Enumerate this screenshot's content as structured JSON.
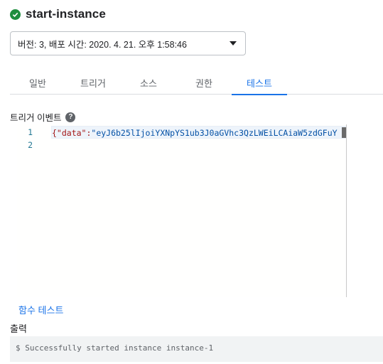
{
  "header": {
    "title": "start-instance",
    "status_icon": "check-circle-icon",
    "status_color": "#1e8e3e"
  },
  "version_select": {
    "value": "버전: 3, 배포 시간: 2020. 4. 21. 오후 1:58:46"
  },
  "tabs": [
    {
      "label": "일반",
      "active": false
    },
    {
      "label": "트리거",
      "active": false
    },
    {
      "label": "소스",
      "active": false
    },
    {
      "label": "권한",
      "active": false
    },
    {
      "label": "테스트",
      "active": true
    }
  ],
  "trigger_event": {
    "label": "트리거 이벤트",
    "help_icon": "?"
  },
  "editor": {
    "line_numbers": [
      "1",
      "2"
    ],
    "line1_key": "{\"data\":",
    "line1_value": "\"eyJ6b25lIjoiYXNpYS1ub3J0aGVhc3QzLWEiLCAiaW5zdGFuY"
  },
  "test_button": {
    "label": "함수 테스트"
  },
  "output": {
    "label": "출력",
    "text": "$ Successfully started instance instance-1"
  },
  "colors": {
    "accent": "#1a73e8",
    "success": "#1e8e3e"
  }
}
